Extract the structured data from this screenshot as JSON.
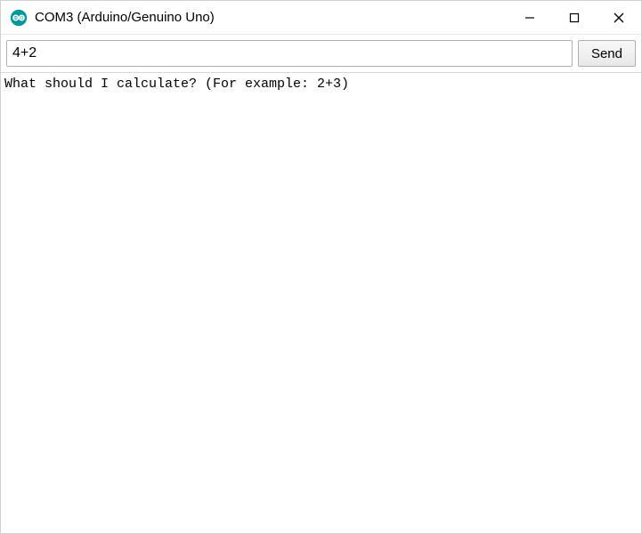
{
  "window": {
    "title": "COM3 (Arduino/Genuino Uno)"
  },
  "icons": {
    "app": "arduino-infinity-icon",
    "minimize": "minimize-icon",
    "maximize": "maximize-icon",
    "close": "close-icon"
  },
  "input": {
    "value": "4+2"
  },
  "buttons": {
    "send": "Send"
  },
  "output": {
    "text": "What should I calculate? (For example: 2+3)"
  },
  "colors": {
    "arduino_teal": "#00979D"
  }
}
